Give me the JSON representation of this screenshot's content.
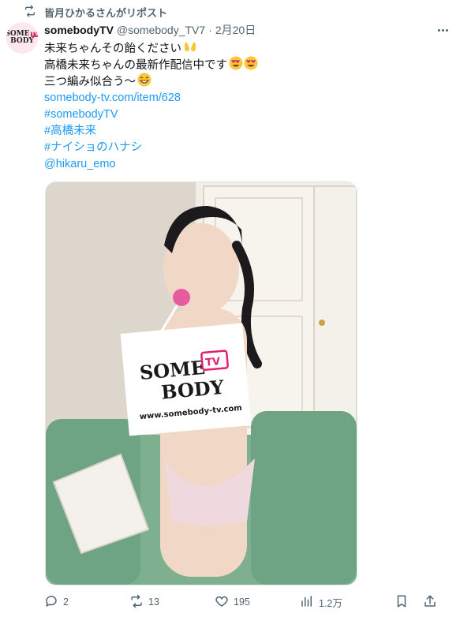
{
  "repost": {
    "icon": "repost-icon",
    "text": "皆月ひかるさんがリポスト"
  },
  "post": {
    "avatar": {
      "line1": "SOME",
      "badge": "TV",
      "line2": "BODY"
    },
    "author_name": "somebodyTV",
    "handle": "@somebody_TV7",
    "separator": "·",
    "date": "2月20日",
    "lines": [
      {
        "text": "未来ちゃんその飴ください",
        "emoji": "open-hands-emoji"
      },
      {
        "text": "高橋未来ちゃんの最新作配信中です",
        "emoji": "heart-eyes-emoji-x2"
      },
      {
        "text": "三つ編み似合う〜",
        "emoji": "grinning-emoji"
      }
    ],
    "link": "somebody-tv.com/item/628",
    "hashtags": [
      "#somebodyTV",
      "#高橋未来",
      "#ナイショのハナシ"
    ],
    "mention": "@hikaru_emo",
    "image": {
      "description_icon": "post-photo",
      "sign": {
        "line1": "SOME",
        "badge": "TV",
        "line2": "BODY",
        "url": "www.somebody-tv.com"
      }
    }
  },
  "actions": {
    "replies": "2",
    "reposts": "13",
    "likes": "195",
    "views": "1.2万"
  },
  "colors": {
    "accent": "#1d9bf0",
    "muted": "#536471",
    "brand_pink": "#e0226f"
  }
}
